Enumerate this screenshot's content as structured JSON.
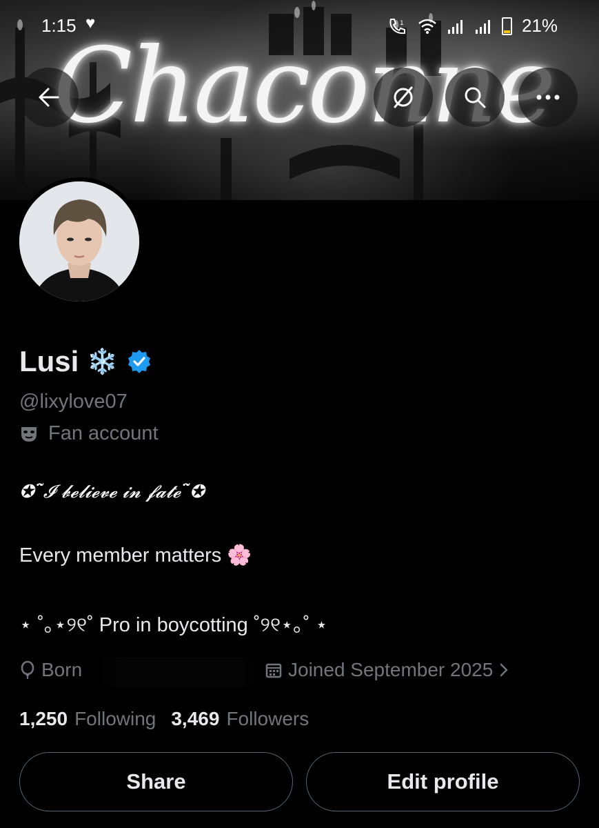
{
  "status_bar": {
    "time": "1:15",
    "battery": "21%",
    "icons": [
      "heart-icon",
      "call-icon",
      "wifi-icon",
      "signal-icon",
      "battery-icon"
    ]
  },
  "banner": {
    "title": "Chaconne"
  },
  "nav": {
    "back_icon": "back-arrow-icon",
    "grok_icon": "grok-icon",
    "search_icon": "search-icon",
    "more_icon": "more-icon"
  },
  "profile": {
    "name": "Lusi",
    "name_emoji": "❄️",
    "verified": true,
    "handle": "@lixylove07",
    "label": "Fan account",
    "bio_line1": "✪˜̈𝓘 𝓫𝓮𝓵𝓲𝓮𝓿𝓮 𝓲𝓷 𝓯𝓪𝓽𝓮˜̈✪",
    "bio_line2": "Every member matters 🌸",
    "bio_line3": "⋆ ˚｡⋆୨୧˚ Pro in boycotting ˚୨୧⋆｡˚ ⋆",
    "born_label": "Born",
    "joined": "Joined September 2025"
  },
  "stats": {
    "following_count": "1,250",
    "following_label": "Following",
    "followers_count": "3,469",
    "followers_label": "Followers"
  },
  "buttons": {
    "share": "Share",
    "edit_profile": "Edit profile"
  },
  "colors": {
    "background": "#000000",
    "text_primary": "#e7e9ea",
    "text_secondary": "#71767b",
    "verified_blue": "#1d9bf0",
    "button_border": "#536471"
  }
}
